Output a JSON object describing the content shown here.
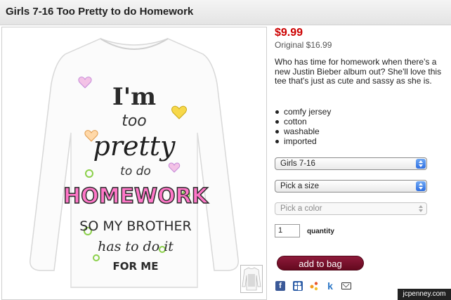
{
  "product": {
    "title": "Girls 7-16 Too Pretty to do Homework",
    "price": "$9.99",
    "original_price": "Original $16.99",
    "description": "Who has time for homework when there's a new Justin Bieber album out? She'll love this tee that's just as cute and sassy as she is.",
    "features": [
      "comfy jersey",
      "cotton",
      "washable",
      "imported"
    ]
  },
  "shirt_print": {
    "line1": "I'm",
    "line2": "too",
    "line3": "pretty",
    "line4": "to do",
    "line5": "HOMEWORK",
    "line6": "SO MY BROTHER",
    "line7": "has to do it",
    "line8": "FOR ME"
  },
  "options": {
    "size_range": "Girls 7-16",
    "size_placeholder": "Pick a size",
    "color_placeholder": "Pick a color"
  },
  "quantity": {
    "value": "1",
    "label": "quantity"
  },
  "actions": {
    "add_to_bag": "add to bag"
  },
  "share": {
    "facebook": "f",
    "myspace": "M",
    "share": "",
    "kaboodle": "k",
    "email": ""
  },
  "watermark": "jcpenney.com",
  "colors": {
    "price_red": "#cc0000",
    "button_maroon": "#7a1030",
    "select_arrow_blue": "#2f6fe0"
  }
}
